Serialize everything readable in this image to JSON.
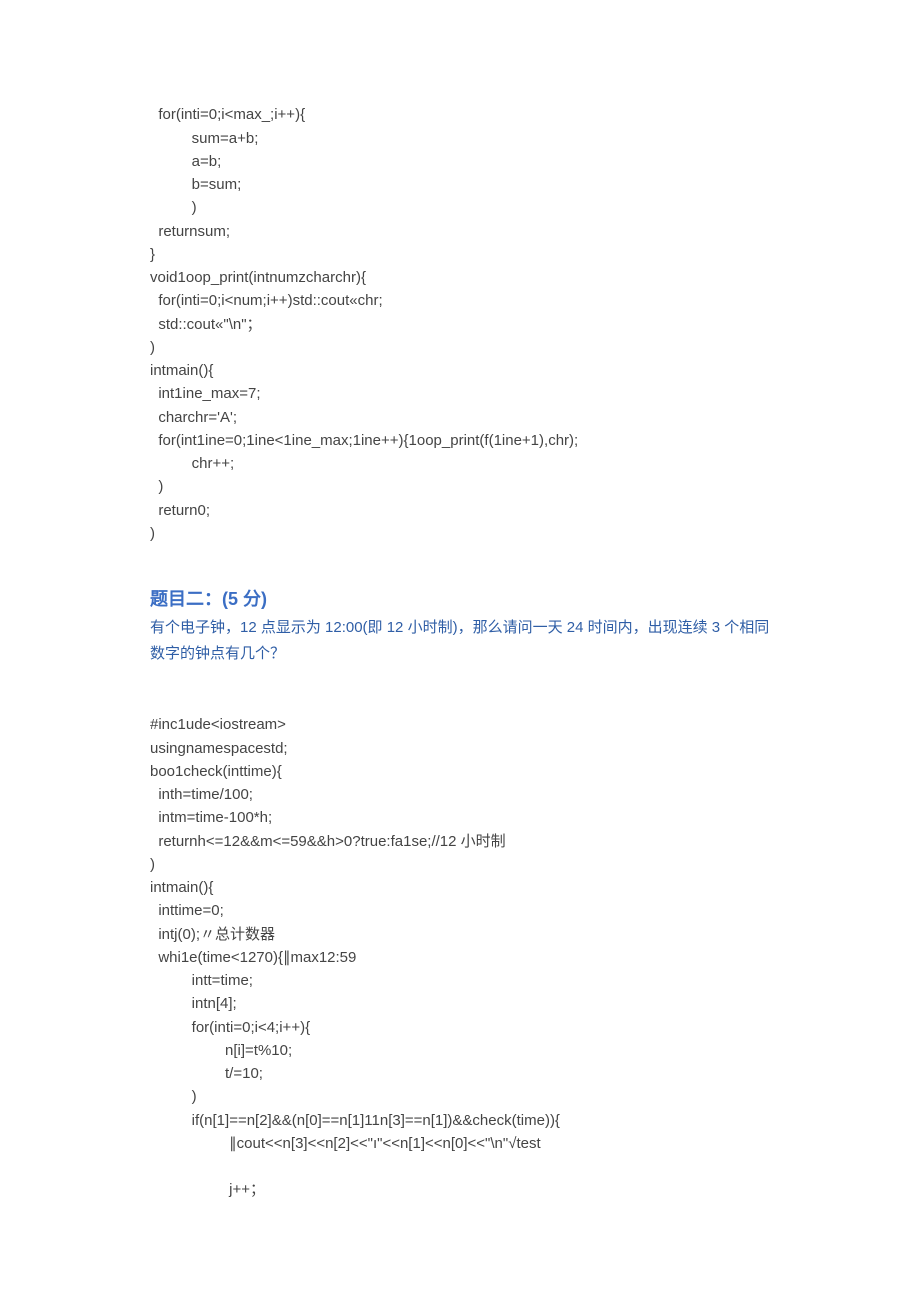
{
  "codeBlock1": {
    "l1": "  for(inti=0;i<max_;i++){",
    "l2": "          sum=a+b;",
    "l3": "          a=b;",
    "l4": "          b=sum;",
    "l5": "          )",
    "l6": "  returnsum;",
    "l7": "}",
    "l8": "void1oop_print(intnumzcharchr){",
    "l9": "  for(inti=0;i<num;i++)std::cout«chr;",
    "l10": "  std::cout«\"\\n\"；",
    "l11": ")",
    "l12": "intmain(){",
    "l13": "  int1ine_max=7;",
    "l14": "  charchr='A';",
    "l15": "  for(int1ine=0;1ine<1ine_max;1ine++){1oop_print(f(1ine+1),chr);",
    "l16": "          chr++;",
    "l17": "  )",
    "l18": "  return0;",
    "l19": ")"
  },
  "heading2": "题目二：(5 分)",
  "desc2_line1": "有个电子钟，12 点显示为 12:00(即 12 小时制)，那么请问一天 24 时间内，出现连续 3 个相同",
  "desc2_line2": "数字的钟点有几个？",
  "codeBlock2": {
    "l1": "#inc1ude<iostream>",
    "l2": "usingnamespacestd;",
    "l3": "boo1check(inttime){",
    "l4": "  inth=time/100;",
    "l5": "  intm=time-100*h;",
    "l6": "  returnh<=12&&m<=59&&h>0?true:fa1se;//12 小时制",
    "l7": ")",
    "l8": "intmain(){",
    "l9": "  inttime=0;",
    "l10": "  intj(0);〃总计数器",
    "l11": "  whi1e(time<1270){∥max12:59",
    "l12": "          intt=time;",
    "l13": "          intn[4];",
    "l14": "          for(inti=0;i<4;i++){",
    "l15": "                  n[i]=t%10;",
    "l16": "                  t/=10;",
    "l17": "          )",
    "l18": "          if(n[1]==n[2]&&(n[0]==n[1]11n[3]==n[1])&&check(time)){",
    "l19": "                   ∥cout<<n[3]<<n[2]<<\"ı\"<<n[1]<<n[0]<<\"\\n\"√test",
    "l20": "                   j++；"
  }
}
